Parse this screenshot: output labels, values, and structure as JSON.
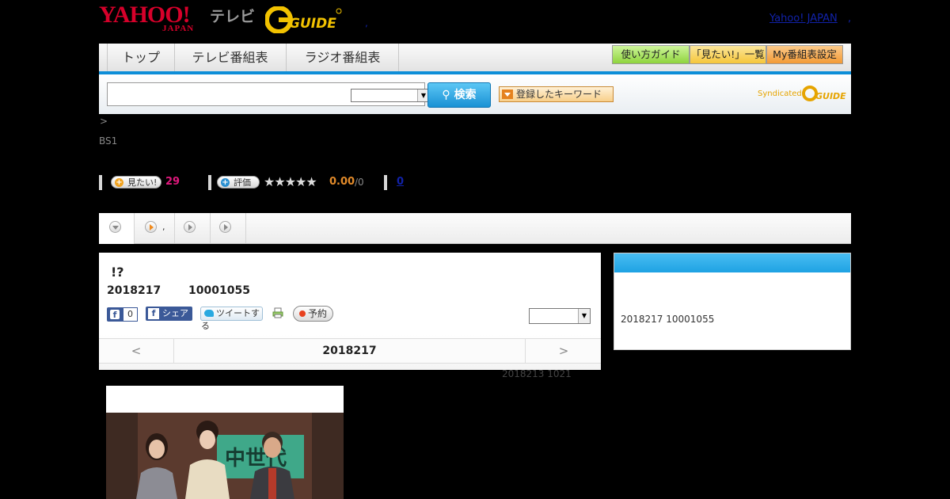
{
  "header": {
    "yahoo_logo": "YAHOO!",
    "yahoo_logo_sub": "JAPAN",
    "tv_label": "テレビ",
    "gguide_logo": "G GUIDE",
    "dot": ",",
    "yahoo_japan_link": "Yahoo! JAPAN",
    "yahoo_japan_link_sep": ","
  },
  "nav": {
    "tabs": [
      "トップ",
      "テレビ番組表",
      "ラジオ番組表"
    ],
    "buttons": [
      "使い方ガイド",
      "「見たい!」一覧",
      "My番組表設定"
    ]
  },
  "search": {
    "input_value": "",
    "select_value": "",
    "button_label": "検索",
    "keyword_button": "登録したキーワード",
    "syndicated_label": "Syndicated"
  },
  "breadcrumb": ">",
  "channel": "BS1",
  "actions": {
    "mitai_label": "見たい!",
    "mitai_count": "29",
    "rate_label": "評価",
    "stars": "★★★★★",
    "score": "0.00",
    "score_max": "/0",
    "review_count": "0"
  },
  "tabs": {
    "tab2_label": ","
  },
  "program": {
    "title": "!?",
    "date": "2018217",
    "time": "10001055",
    "fb_like_count": "0",
    "fb_share_label": "シェア",
    "tweet_label": "ツイートする",
    "record_label": "予約",
    "select_value": "",
    "day_prev": "<",
    "day_current": "2018217",
    "day_next": ">",
    "updated": "2018213  1021"
  },
  "side": {
    "heading": "",
    "text": "2018217  10001055"
  },
  "colors": {
    "accent_blue": "#0d8ed8",
    "yahoo_red": "#d6002a",
    "mitai_pink": "#e0197d",
    "score_orange": "#e38b2a"
  }
}
